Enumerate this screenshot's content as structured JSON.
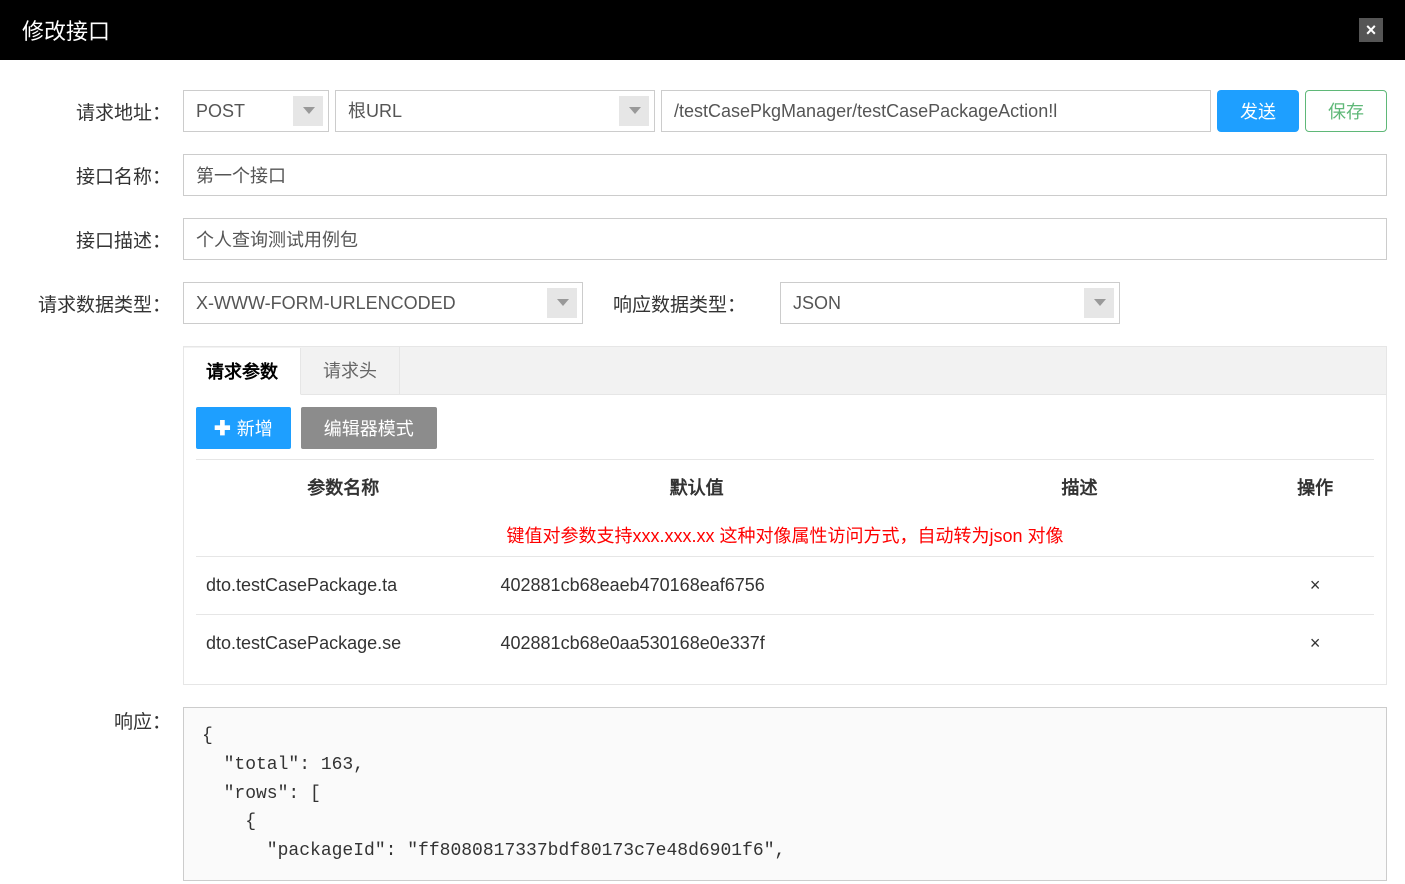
{
  "header": {
    "title": "修改接口",
    "close": "×"
  },
  "labels": {
    "request_url": "请求地址：",
    "interface_name": "接口名称：",
    "interface_desc": "接口描述：",
    "request_data_type": "请求数据类型：",
    "response_data_type": "响应数据类型：",
    "response": "响应："
  },
  "buttons": {
    "send": "发送",
    "save": "保存",
    "add": "新增",
    "editor_mode": "编辑器模式"
  },
  "form": {
    "method": "POST",
    "base_url": "根URL",
    "url_path": "/testCasePkgManager/testCasePackageAction!l",
    "name": "第一个接口",
    "description": "个人查询测试用例包",
    "request_type": "X-WWW-FORM-URLENCODED",
    "response_type": "JSON"
  },
  "tabs": {
    "params": "请求参数",
    "headers": "请求头"
  },
  "param_table": {
    "columns": {
      "name": "参数名称",
      "default": "默认值",
      "desc": "描述",
      "action": "操作"
    },
    "hint": "键值对参数支持xxx.xxx.xx 这种对像属性访问方式，自动转为json 对像",
    "rows": [
      {
        "name": "dto.testCasePackage.ta",
        "value": "402881cb68eaeb470168eaf6756",
        "desc": ""
      },
      {
        "name": "dto.testCasePackage.se",
        "value": "402881cb68e0aa530168e0e337f",
        "desc": ""
      }
    ]
  },
  "response_body": "{\n  \"total\": 163,\n  \"rows\": [\n    {\n      \"packageId\": \"ff8080817337bdf80173c7e48d6901f6\","
}
